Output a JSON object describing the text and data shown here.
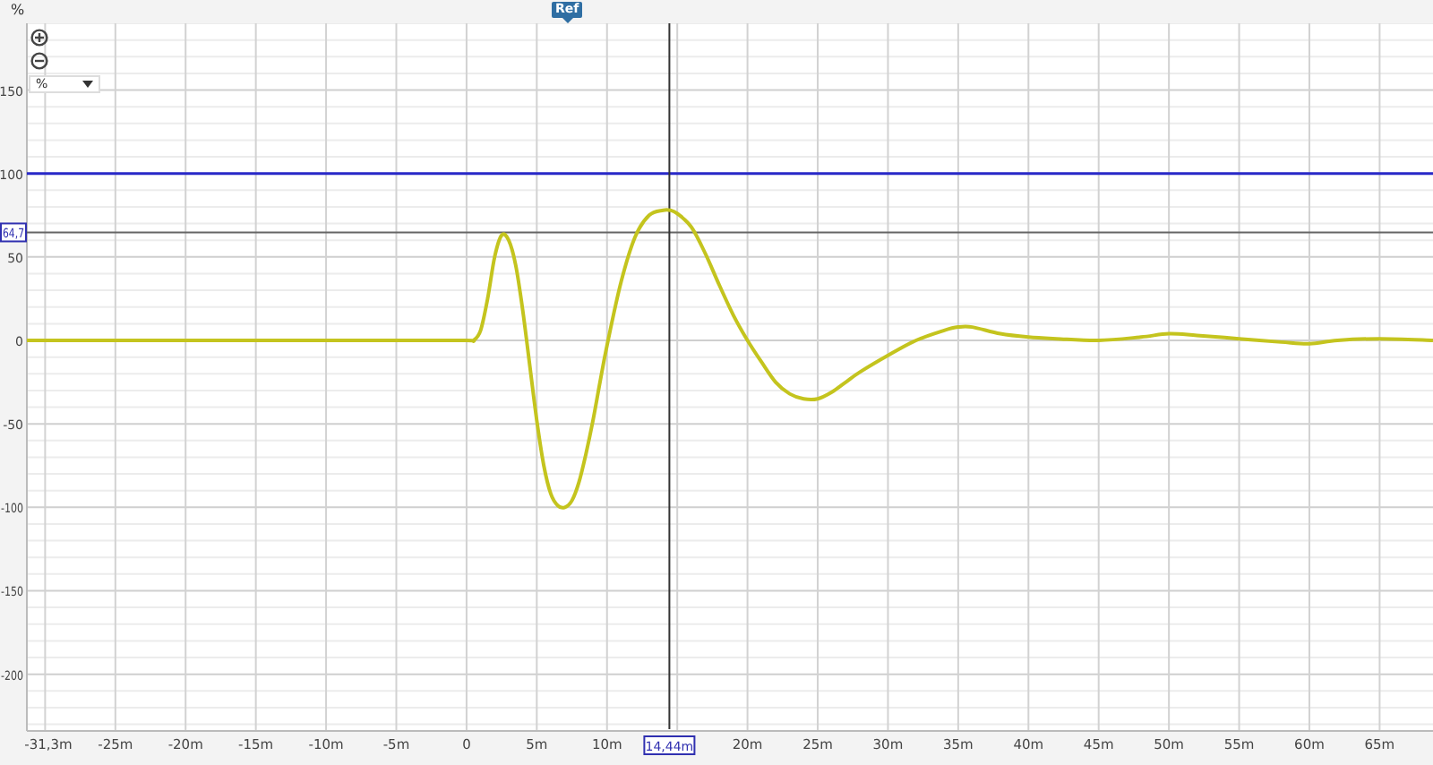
{
  "top_bar": {
    "unit_label": "%",
    "ref_marker": "Ref"
  },
  "controls": {
    "unit_dropdown": {
      "value": "%"
    }
  },
  "chart_data": {
    "type": "line",
    "x": [
      -31.3,
      -5,
      0,
      0.5,
      1,
      1.5,
      2,
      2.5,
      3,
      3.5,
      4,
      4.5,
      5,
      5.5,
      6,
      6.5,
      7,
      7.5,
      8,
      8.5,
      9,
      9.5,
      10,
      11,
      12,
      13,
      14,
      14.5,
      15,
      16,
      17,
      18,
      19,
      20,
      21,
      22,
      23,
      24,
      25,
      26,
      27,
      28,
      30,
      32,
      34,
      35,
      36,
      38,
      40,
      42,
      45,
      48,
      50,
      52,
      55,
      58,
      60,
      62,
      65,
      68.8
    ],
    "series": [
      {
        "color": "#c4c41e",
        "values": [
          0,
          0,
          0,
          0,
          6,
          25,
          50,
          63,
          60,
          45,
          18,
          -15,
          -48,
          -75,
          -92,
          -99,
          -100,
          -96,
          -85,
          -68,
          -48,
          -25,
          -3,
          35,
          62,
          75,
          78,
          78,
          76,
          68,
          52,
          33,
          15,
          0,
          -13,
          -25,
          -32,
          -35,
          -35,
          -31,
          -25,
          -19,
          -9,
          0,
          6,
          8,
          8,
          4,
          2,
          1,
          0,
          2,
          4,
          3,
          1,
          -1,
          -2,
          0,
          1,
          0
        ]
      }
    ],
    "xlim": [
      -31.3,
      68.8
    ],
    "ylim": [
      -234,
      190
    ],
    "xticks": [
      {
        "value": -31.3,
        "label": "-31,3m"
      },
      {
        "value": -25,
        "label": "-25m"
      },
      {
        "value": -20,
        "label": "-20m"
      },
      {
        "value": -15,
        "label": "-15m"
      },
      {
        "value": -10,
        "label": "-10m"
      },
      {
        "value": -5,
        "label": "-5m"
      },
      {
        "value": 0,
        "label": "0"
      },
      {
        "value": 5,
        "label": "5m"
      },
      {
        "value": 10,
        "label": "10m"
      },
      {
        "value": 20,
        "label": "20m"
      },
      {
        "value": 25,
        "label": "25m"
      },
      {
        "value": 30,
        "label": "30m"
      },
      {
        "value": 35,
        "label": "35m"
      },
      {
        "value": 40,
        "label": "40m"
      },
      {
        "value": 45,
        "label": "45m"
      },
      {
        "value": 50,
        "label": "50m"
      },
      {
        "value": 55,
        "label": "55m"
      },
      {
        "value": 60,
        "label": "60m"
      },
      {
        "value": 65,
        "label": "65m"
      }
    ],
    "yticks": [
      150,
      100,
      50,
      0,
      -50,
      -100,
      -150,
      -200
    ],
    "grid": true,
    "ref_lines": [
      {
        "axis": "y",
        "value": 100,
        "color": "#2828c8"
      },
      {
        "axis": "y",
        "value": 64.7,
        "color": "#666666",
        "label": "64,7"
      },
      {
        "axis": "x",
        "value": 14.44,
        "color": "#333333",
        "label": "14,44m"
      }
    ]
  }
}
